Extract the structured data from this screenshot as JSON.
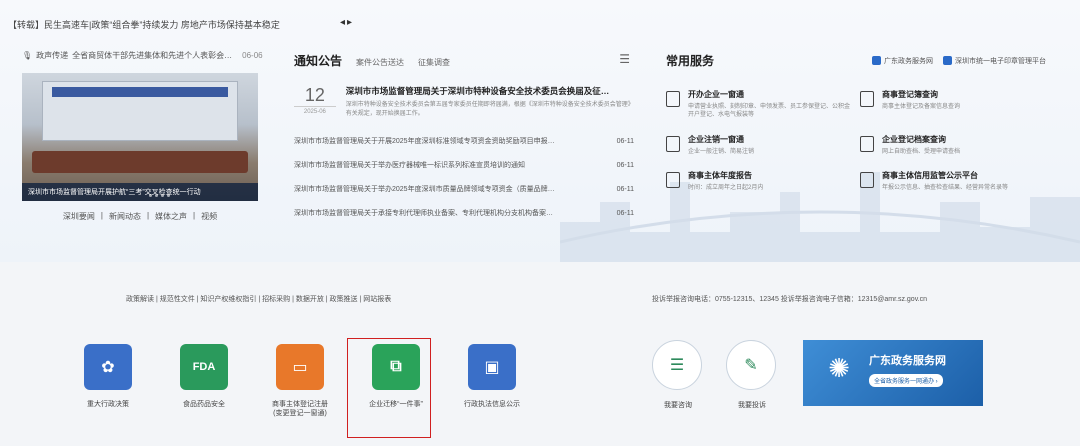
{
  "ticker": {
    "text": "【转载】民生高速车|政策“组合拳”持续发力 房地产市场保持基本稳定",
    "arrows": "◂▸"
  },
  "left": {
    "news_source": "政声传递",
    "news_title": "全省商贸体干部先进集体和先进个人表彰会…",
    "news_date": "06-06",
    "photo_caption": "深圳市市场监督管理局开展护航“三考”交叉检查统一行动",
    "sub_links": [
      "深圳要闻",
      "|",
      "新闻动态",
      "|",
      "媒体之声",
      "|",
      "视频"
    ]
  },
  "notices": {
    "tab_main": "通知公告",
    "tabs": [
      "案件公告送达",
      "征集调查"
    ],
    "featured": {
      "day": "12",
      "ym": "2025-06",
      "title": "深圳市市场监督管理局关于深圳市特种设备安全技术委员会换届及征…",
      "desc": "深圳市特种设备安全技术委员会第五届专家委员任期即将届满，根据《深圳市特种设备安全技术委员会管理》有关规定，现开始换届工作。"
    },
    "items": [
      {
        "title": "深圳市市场监督管理局关于开展2025年度深圳标准领域专项资金资助奖励项目申报…",
        "date": "06-11"
      },
      {
        "title": "深圳市市场监督管理局关于举办医疗器械唯一标识系列标准宣贯培训的通知",
        "date": "06-11"
      },
      {
        "title": "深圳市市场监督管理局关于举办2025年度深圳市质量品牌领域专项资金（质量品牌…",
        "date": "06-11"
      },
      {
        "title": "深圳市市场监督管理局关于承接专利代理师执业备案、专利代理机构分支机构备案…",
        "date": "06-11"
      }
    ]
  },
  "services": {
    "title": "常用服务",
    "link1": "广东政务服务网",
    "link2": "深圳市统一电子印章管理平台",
    "items": [
      {
        "name": "开办企业一窗通",
        "desc": "申请营业执照、刻制印章、申领发票、员工参保登记、公积金开户登记、水电气报装等"
      },
      {
        "name": "商事登记簿查询",
        "desc": "商事主体登记及备案信息查询"
      },
      {
        "name": "企业注销一窗通",
        "desc": "企业一般注销、简易注销"
      },
      {
        "name": "企业登记档案查询",
        "desc": "网上自助查档、受理申请查档"
      },
      {
        "name": "商事主体年度报告",
        "desc": "时间：成立周年之日起2月内"
      },
      {
        "name": "商事主体信用监管公示平台",
        "desc": "年报公示信息、抽查检查结果、经营异常名录等"
      }
    ]
  },
  "footer": {
    "links": "政策解读 | 规范性文件 | 知识产权维权指引 | 招标采购 | 数据开放 | 政策推送 | 网站报表",
    "contact": "投诉举报咨询电话：0755-12315、12345    投诉举报咨询电子信箱：12315@amr.sz.gov.cn"
  },
  "tiles": [
    {
      "label": "重大行政决策",
      "color": "#3a6fc8",
      "glyph": "✿"
    },
    {
      "label": "食品药品安全",
      "color": "#2a9a5c",
      "glyph": "FDA"
    },
    {
      "label": "商事主体登记注册\n(变更登记一窗通)",
      "color": "#e8782a",
      "glyph": "▭"
    },
    {
      "label": "企业迁移“一件事”",
      "color": "#2aa35a",
      "glyph": "⧉"
    },
    {
      "label": "行政执法信息公示",
      "color": "#3a6fc8",
      "glyph": "▣"
    }
  ],
  "circles": [
    {
      "label": "我要咨询",
      "glyph": "☰"
    },
    {
      "label": "我要投诉",
      "glyph": "✎"
    }
  ],
  "gov_banner": {
    "title": "广东政务服务网",
    "button": "全省政务服务一网通办 ›",
    "logo": "✺"
  }
}
